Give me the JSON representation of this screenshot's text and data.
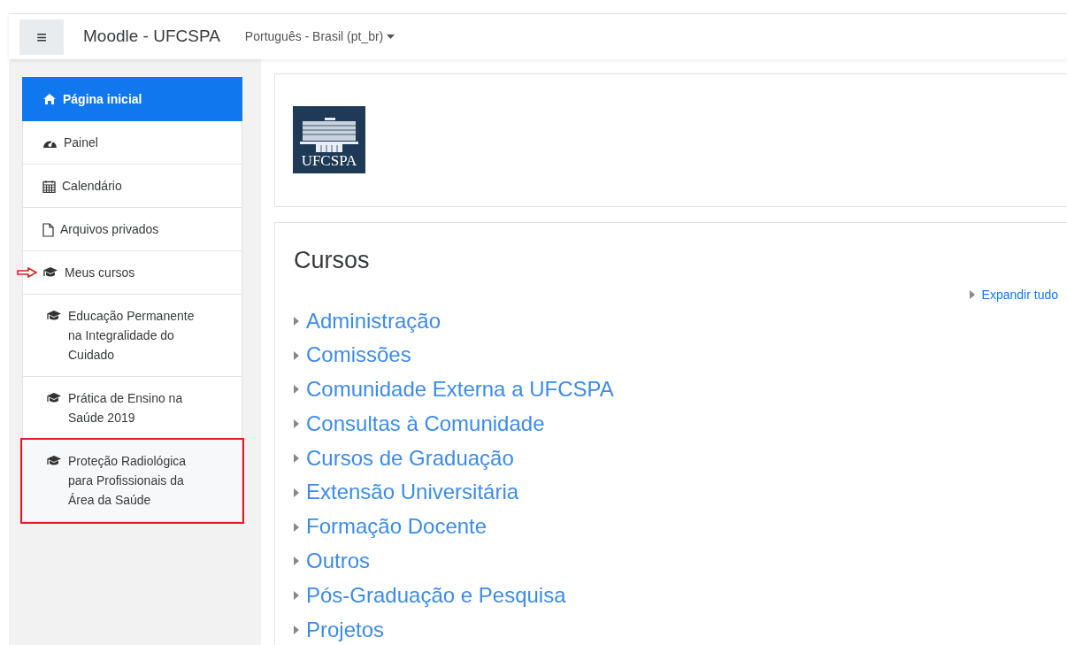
{
  "navbar": {
    "menu_toggle": "≡",
    "site_name": "Moodle - UFCSPA",
    "language": "Português - Brasil (pt_br)"
  },
  "sidebar": {
    "items": [
      {
        "label": "Página inicial",
        "kind": "home",
        "selected": true,
        "highlighted": false,
        "arrow_marked": false
      },
      {
        "label": "Painel",
        "kind": "dashboard",
        "selected": false,
        "highlighted": false,
        "arrow_marked": false
      },
      {
        "label": "Calendário",
        "kind": "calendar",
        "selected": false,
        "highlighted": false,
        "arrow_marked": false
      },
      {
        "label": "Arquivos privados",
        "kind": "file",
        "selected": false,
        "highlighted": false,
        "arrow_marked": false
      },
      {
        "label": "Meus cursos",
        "kind": "course",
        "selected": false,
        "highlighted": false,
        "arrow_marked": true,
        "children": [
          {
            "label": "Educação Permanente na Integralidade do Cuidado",
            "kind": "course",
            "selected": false,
            "highlighted": false,
            "arrow_marked": false
          },
          {
            "label": "Prática de Ensino na Saúde 2019",
            "kind": "course",
            "selected": false,
            "highlighted": false,
            "arrow_marked": false
          },
          {
            "label": "Proteção Radiológica para Profissionais da Área da Saúde",
            "kind": "course",
            "selected": false,
            "highlighted": true,
            "arrow_marked": false
          }
        ]
      }
    ]
  },
  "header_card": {
    "logo_text": "UFCSPA"
  },
  "courses": {
    "title": "Cursos",
    "expand_all": "Expandir tudo",
    "categories": [
      {
        "label": "Administração",
        "expanded": false
      },
      {
        "label": "Comissões",
        "expanded": false
      },
      {
        "label": "Comunidade Externa a UFCSPA",
        "expanded": false
      },
      {
        "label": "Consultas à Comunidade",
        "expanded": false
      },
      {
        "label": "Cursos de Graduação",
        "expanded": false
      },
      {
        "label": "Extensão Universitária",
        "expanded": false
      },
      {
        "label": "Formação Docente",
        "expanded": false
      },
      {
        "label": "Outros",
        "expanded": false
      },
      {
        "label": "Pós-Graduação e Pesquisa",
        "expanded": false
      },
      {
        "label": "Projetos",
        "expanded": false
      }
    ]
  }
}
